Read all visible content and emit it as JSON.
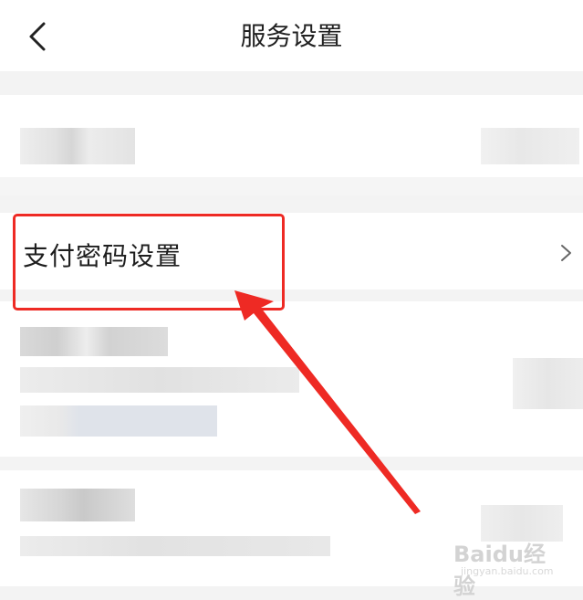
{
  "header": {
    "title": "服务设置",
    "back_icon": "chevron-left-icon"
  },
  "rows": {
    "pay_password_label": "支付密码设置",
    "pay_password_chevron": "chevron-right-icon"
  },
  "annotation": {
    "highlight_color": "#ee2a24",
    "arrow_color": "#ee2a24"
  },
  "watermark": {
    "logo_text": "Baidu经验",
    "url_text": "jingyan.baidu.com"
  }
}
